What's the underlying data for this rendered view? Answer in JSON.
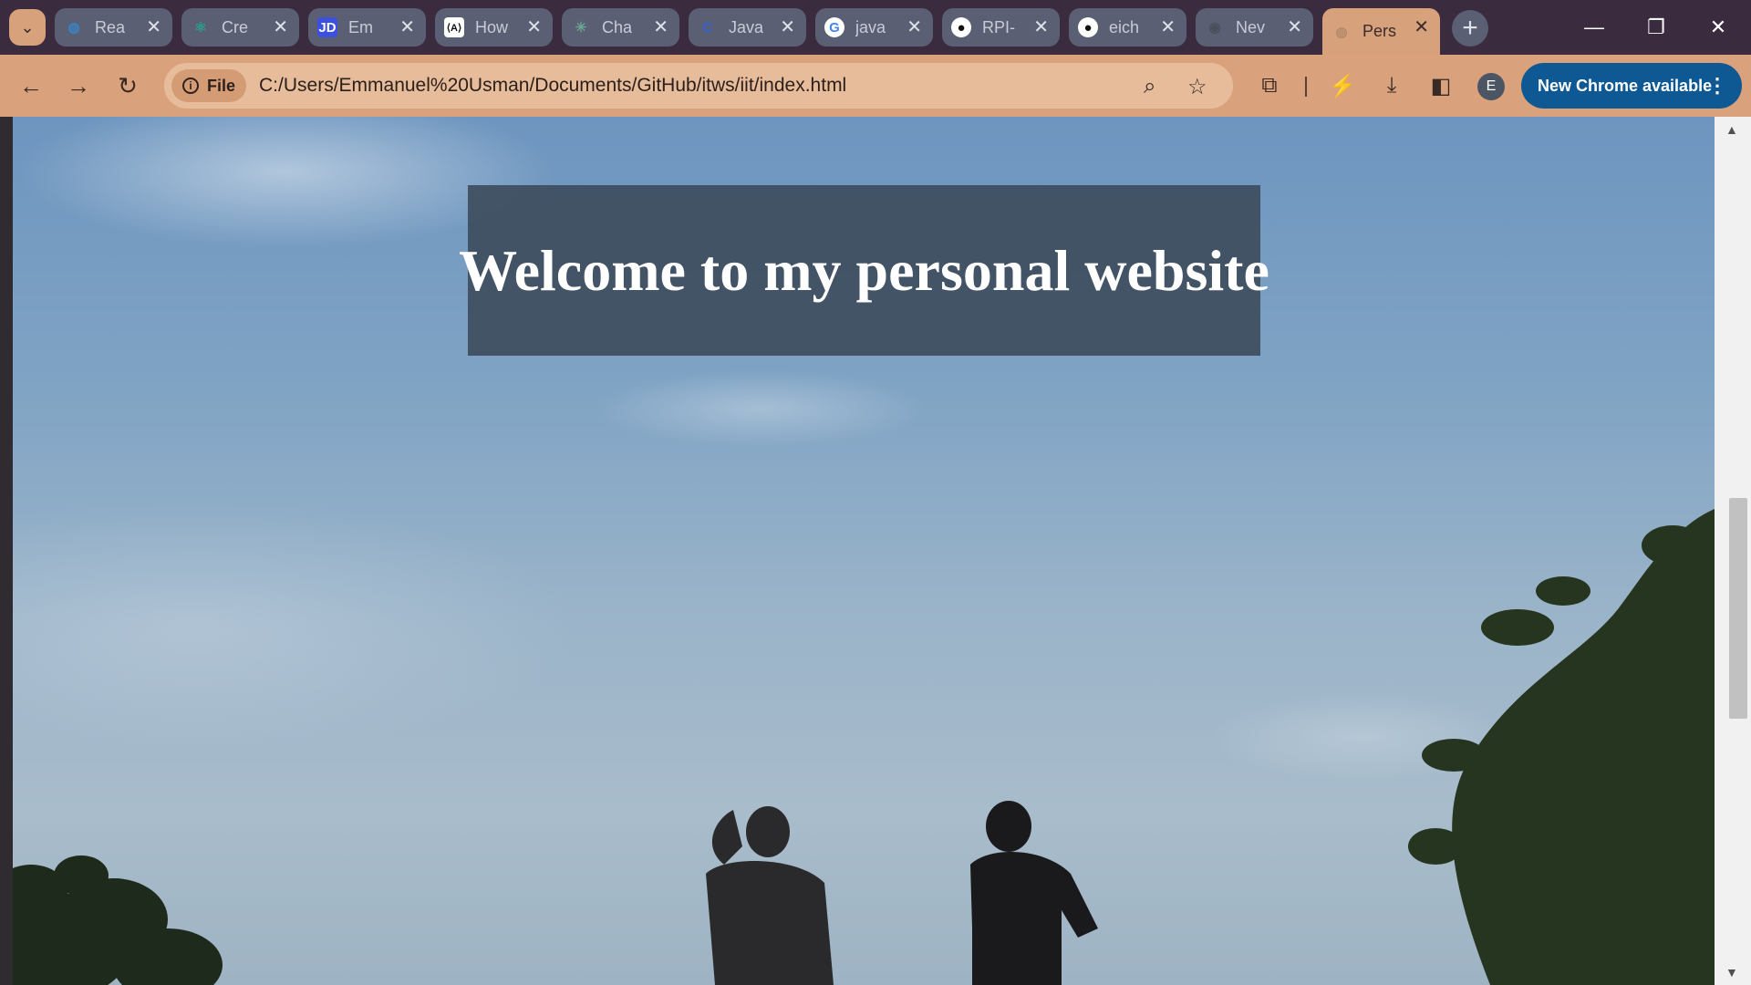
{
  "browser": {
    "tabs": [
      {
        "title": "Rea",
        "favicon": "globe-icon",
        "favicon_glyph": "◍",
        "favicon_color": "#3b82c4"
      },
      {
        "title": "Cre",
        "favicon": "react-icon",
        "favicon_glyph": "⚛",
        "favicon_color": "#2a9d8f"
      },
      {
        "title": "Em",
        "favicon": "jd-icon",
        "favicon_glyph": "JD",
        "favicon_color": "#3c50e0"
      },
      {
        "title": "How",
        "favicon": "code-icon",
        "favicon_glyph": "⟨A⟩",
        "favicon_color": "#111111"
      },
      {
        "title": "Cha",
        "favicon": "chatgpt-icon",
        "favicon_glyph": "✳",
        "favicon_color": "#6aa58f"
      },
      {
        "title": "Java",
        "favicon": "c-icon",
        "favicon_glyph": "C",
        "favicon_color": "#3062d6"
      },
      {
        "title": "java",
        "favicon": "google-icon",
        "favicon_glyph": "G",
        "favicon_color": "#ffffff"
      },
      {
        "title": "RPI-",
        "favicon": "github-icon",
        "favicon_glyph": "●",
        "favicon_color": "#111111"
      },
      {
        "title": "eich",
        "favicon": "github-icon",
        "favicon_glyph": "●",
        "favicon_color": "#111111"
      },
      {
        "title": "Nev",
        "favicon": "chrome-icon",
        "favicon_glyph": "◉",
        "favicon_color": "#4a4f5c"
      },
      {
        "title": "Pers",
        "favicon": "globe-icon",
        "favicon_glyph": "◍",
        "favicon_color": "#b58a6a",
        "active": true
      }
    ],
    "omnibox": {
      "chip_label": "File",
      "url": "C:/Users/Emmanuel%20Usman/Documents/GitHub/itws/iit/index.html"
    },
    "profile_initial": "E",
    "update_label": "New Chrome available",
    "colors": {
      "tabstrip": "#3a2b3e",
      "toolbar": "#d9a27c",
      "update_button": "#0e5893"
    }
  },
  "page": {
    "heading": "Welcome to my personal website"
  }
}
